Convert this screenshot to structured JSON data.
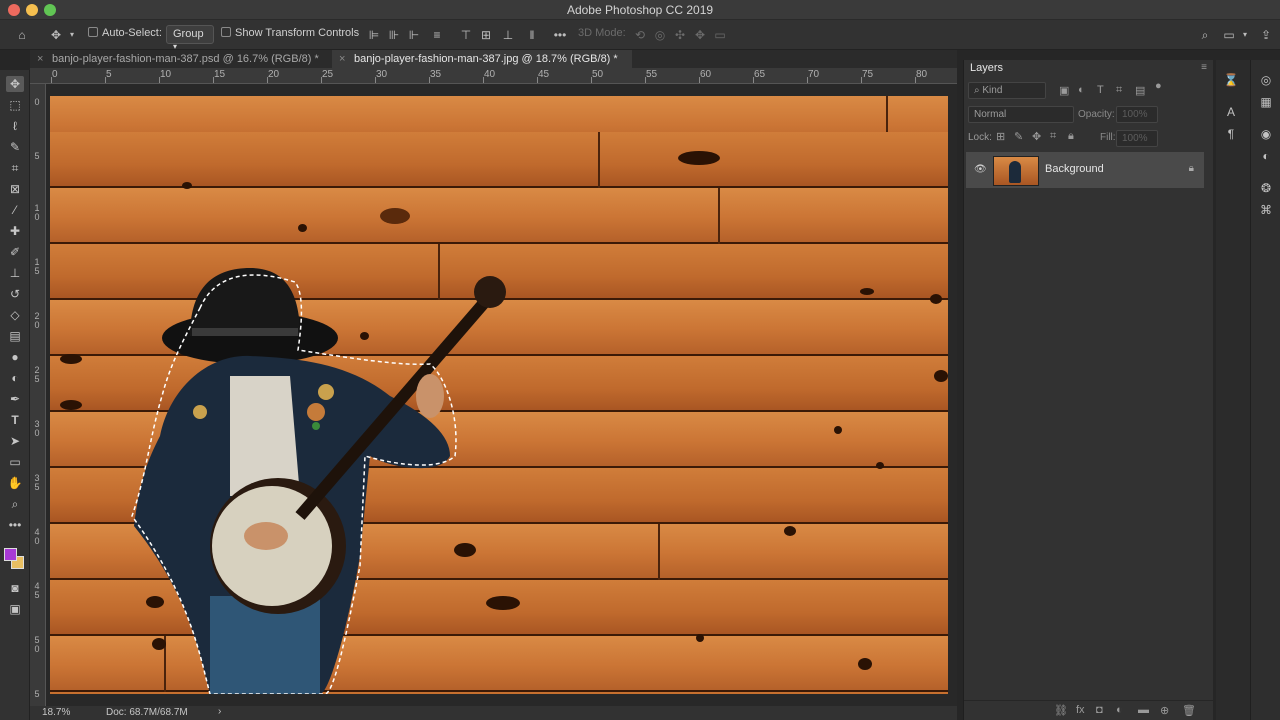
{
  "window": {
    "title": "Adobe Photoshop CC 2019"
  },
  "options": {
    "auto_select_label": "Auto-Select:",
    "auto_select_value": "Group",
    "show_transform_label": "Show Transform Controls",
    "mode_3d_label": "3D Mode:"
  },
  "tabs": [
    {
      "label": "banjo-player-fashion-man-387.psd @ 16.7% (RGB/8) *",
      "active": false
    },
    {
      "label": "banjo-player-fashion-man-387.jpg @ 18.7% (RGB/8) *",
      "active": true
    }
  ],
  "ruler_h": [
    "0",
    "5",
    "10",
    "15",
    "20",
    "25",
    "30",
    "35",
    "40",
    "45",
    "50",
    "55",
    "60",
    "65",
    "70",
    "75",
    "80"
  ],
  "ruler_v": [
    "0",
    "5",
    "1\n0",
    "1\n5",
    "2\n0",
    "2\n5",
    "3\n0",
    "3\n5",
    "4\n0",
    "4\n5",
    "5\n0",
    "5"
  ],
  "status": {
    "zoom": "18.7%",
    "doc": "Doc: 68.7M/68.7M",
    "arrow": "›"
  },
  "layers_panel": {
    "title": "Layers",
    "filter_kind": "Kind",
    "blend_mode": "Normal",
    "opacity_label": "Opacity:",
    "opacity_value": "100%",
    "lock_label": "Lock:",
    "fill_label": "Fill:",
    "fill_value": "100%",
    "layers": [
      {
        "name": "Background",
        "visible": true,
        "locked": true
      }
    ]
  },
  "colors": {
    "foreground": "#a83ad6",
    "background": "#e9bf62"
  }
}
